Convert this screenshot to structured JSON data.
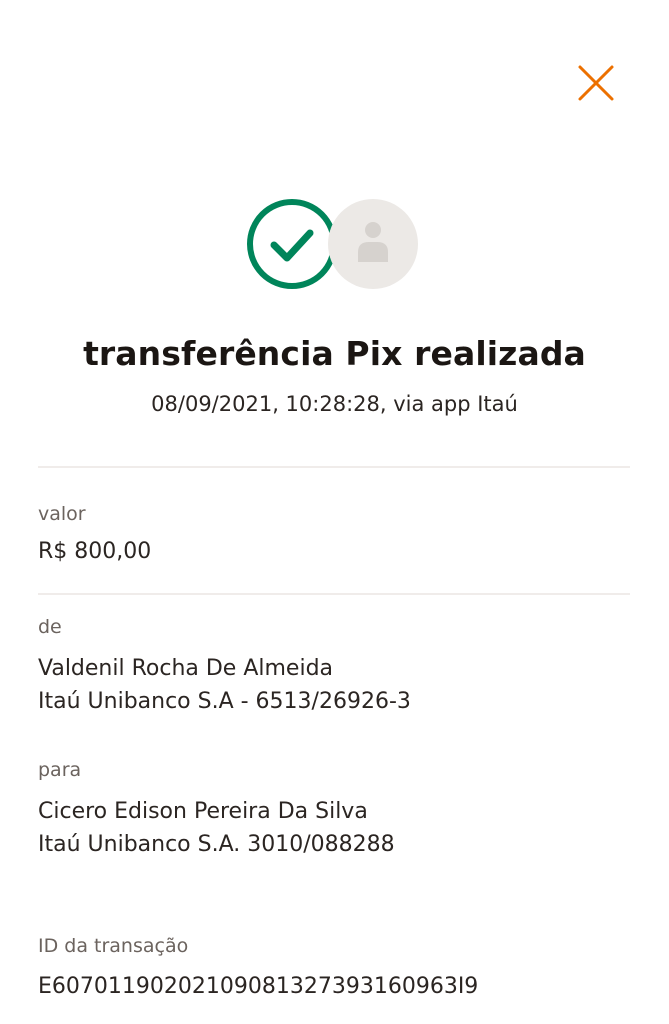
{
  "header": {
    "close_icon": "close-icon",
    "accent_color": "#ec7000"
  },
  "status": {
    "success_icon": "check-circle-icon",
    "success_color": "#00855a",
    "avatar_icon": "person-icon",
    "title": "transferência Pix realizada",
    "datetime": "08/09/2021, 10:28:28, via app Itaú"
  },
  "details": {
    "amount": {
      "label": "valor",
      "value": "R$ 800,00"
    },
    "from": {
      "label": "de",
      "name": "Valdenil Rocha De Almeida",
      "bank": "Itaú Unibanco S.A - 6513/26926-3"
    },
    "to": {
      "label": "para",
      "name": "Cicero Edison Pereira Da Silva",
      "bank": "Itaú Unibanco S.A. 3010/088288"
    },
    "transaction": {
      "label": "ID da transação",
      "id": "E60701190202109081327393160963I9"
    }
  }
}
